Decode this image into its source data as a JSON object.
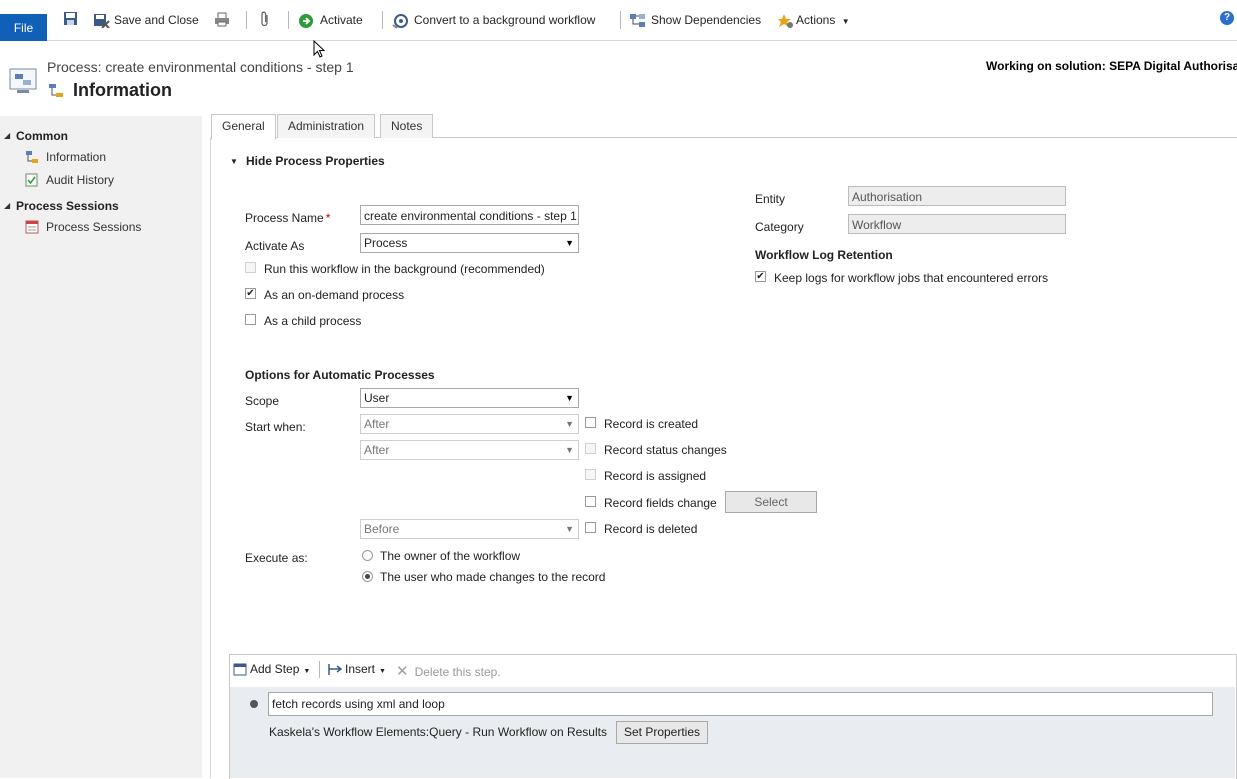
{
  "toolbar": {
    "file_label": "File",
    "save_close_label": "Save and Close",
    "activate_label": "Activate",
    "convert_label": "Convert to a background workflow",
    "dependencies_label": "Show Dependencies",
    "actions_label": "Actions",
    "help_glyph": "?"
  },
  "header": {
    "breadcrumb": "Process: create environmental conditions - step 1",
    "title": "Information",
    "solution": "Working on solution: SEPA Digital Authorisa"
  },
  "sidebar": {
    "groups": [
      {
        "label": "Common",
        "items": [
          {
            "label": "Information"
          },
          {
            "label": "Audit History"
          }
        ]
      },
      {
        "label": "Process Sessions",
        "items": [
          {
            "label": "Process Sessions"
          }
        ]
      }
    ]
  },
  "tabs": [
    {
      "label": "General"
    },
    {
      "label": "Administration"
    },
    {
      "label": "Notes"
    }
  ],
  "form": {
    "section_toggle": "Hide Process Properties",
    "process_name_label": "Process Name",
    "required_mark": "*",
    "process_name_value": "create environmental conditions - step 1",
    "activate_as_label": "Activate As",
    "activate_as_value": "Process",
    "run_background_label": "Run this workflow in the background (recommended)",
    "on_demand_label": "As an on-demand process",
    "child_process_label": "As a child process",
    "entity_label": "Entity",
    "entity_value": "Authorisation",
    "category_label": "Category",
    "category_value": "Workflow",
    "log_retention_heading": "Workflow Log Retention",
    "keep_logs_label": "Keep logs for workflow jobs that encountered errors",
    "auto_heading": "Options for Automatic Processes",
    "scope_label": "Scope",
    "scope_value": "User",
    "start_when_label": "Start when:",
    "start_when_1": "After",
    "start_when_2": "After",
    "start_when_3": "Before",
    "record_created": "Record is created",
    "record_status": "Record status changes",
    "record_assigned": "Record is assigned",
    "record_fields": "Record fields change",
    "select_label": "Select",
    "record_deleted": "Record is deleted",
    "execute_as_label": "Execute as:",
    "execute_owner": "The owner of the workflow",
    "execute_user": "The user who made changes to the record"
  },
  "steps": {
    "add_step": "Add Step",
    "insert": "Insert",
    "delete": "Delete this step.",
    "step_description": "fetch records using xml and loop",
    "step_action": "Kaskela's Workflow Elements:Query - Run Workflow on Results",
    "set_properties": "Set Properties"
  },
  "colors": {
    "file_button": "#1160b7",
    "sidebar_bg": "#f1f1f1",
    "steps_bg": "#e9edf1",
    "required": "#c00000"
  }
}
